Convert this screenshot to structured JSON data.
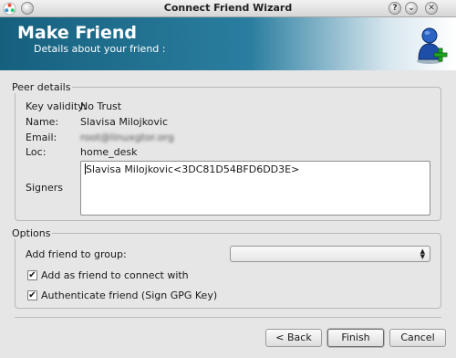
{
  "window": {
    "title": "Connect Friend Wizard",
    "help_glyph": "?",
    "minimize_glyph": "⌄",
    "close_glyph": "✕"
  },
  "banner": {
    "title": "Make Friend",
    "subtitle": "Details about your friend :",
    "icon": "add-user-icon"
  },
  "peer_details": {
    "group_title": "Peer details",
    "key_validity_label": "Key validity:",
    "key_validity_value": "No Trust",
    "name_label": "Name:",
    "name_value": "Slavisa Milojkovic",
    "email_label": "Email:",
    "email_value": "root@linuxgtor.org",
    "loc_label": "Loc:",
    "loc_value": "home_desk",
    "signers_label": "Signers",
    "signers_value": "Slavisa Milojkovic<3DC81D54BFD6DD3E>"
  },
  "options": {
    "group_title": "Options",
    "add_to_group_label": "Add friend to group:",
    "group_selected": "",
    "add_as_friend_label": "Add as friend to connect with",
    "add_as_friend_checked": true,
    "authenticate_label": "Authenticate friend (Sign GPG Key)",
    "authenticate_checked": true,
    "check_glyph": "✔"
  },
  "buttons": {
    "back": "< Back",
    "finish": "Finish",
    "cancel": "Cancel"
  },
  "colors": {
    "banner_dark": "#16607e",
    "banner_mid": "#2b7ea0",
    "window_bg": "#e6e6e6"
  }
}
